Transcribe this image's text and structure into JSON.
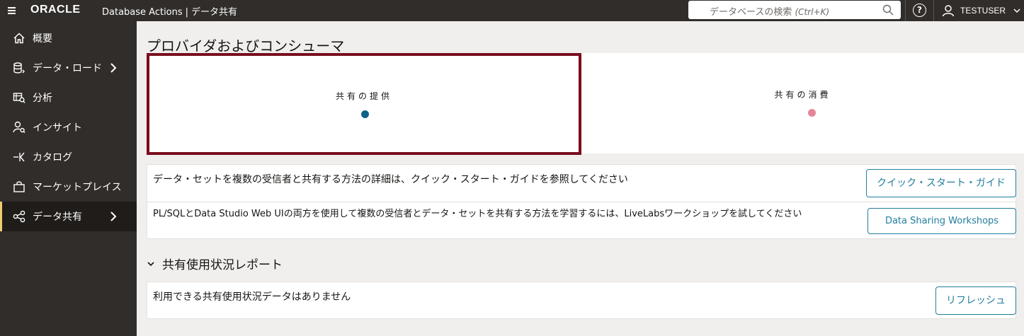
{
  "topbar": {
    "logo": "ORACLE",
    "product": "Database Actions",
    "separator": "|",
    "section": "データ共有",
    "search_placeholder": "データベースの検索",
    "search_shortcut": "(Ctrl+K)",
    "help_icon": "?",
    "user": "TESTUSER"
  },
  "sidebar": {
    "items": [
      {
        "label": "概要",
        "icon": "home-icon"
      },
      {
        "label": "データ・ロード",
        "icon": "database-load-icon",
        "has_submenu": true
      },
      {
        "label": "分析",
        "icon": "analysis-icon"
      },
      {
        "label": "インサイト",
        "icon": "insight-icon"
      },
      {
        "label": "カタログ",
        "icon": "catalog-icon"
      },
      {
        "label": "マーケットプレイス",
        "icon": "marketplace-icon"
      },
      {
        "label": "データ共有",
        "icon": "data-share-icon",
        "has_submenu": true,
        "active": true
      }
    ]
  },
  "main": {
    "title": "プロバイダおよびコンシューマ",
    "cards": [
      {
        "label": "共有の提供",
        "selected": true,
        "dot_color": "#0f6187"
      },
      {
        "label": "共有の消費",
        "selected": false,
        "dot_color": "#e5859a"
      }
    ],
    "info": {
      "quickstart_text": "データ・セットを複数の受信者と共有する方法の詳細は、クイック・スタート・ガイドを参照してください",
      "quickstart_button": "クイック・スタート・ガイド",
      "livelabs_text": "PL/SQLとData Studio Web UIの両方を使用して複数の受信者とデータ・セットを共有する方法を学習するには、LiveLabsワークショップを試してください",
      "livelabs_button": "Data Sharing Workshops"
    },
    "report": {
      "title": "共有使用状況レポート",
      "empty_text": "利用できる共有使用状況データはありません",
      "refresh_button": "リフレッシュ"
    }
  },
  "colors": {
    "topbar_bg": "#312d2a",
    "accent": "#227e9e",
    "selected_border": "#7a0d1d"
  }
}
